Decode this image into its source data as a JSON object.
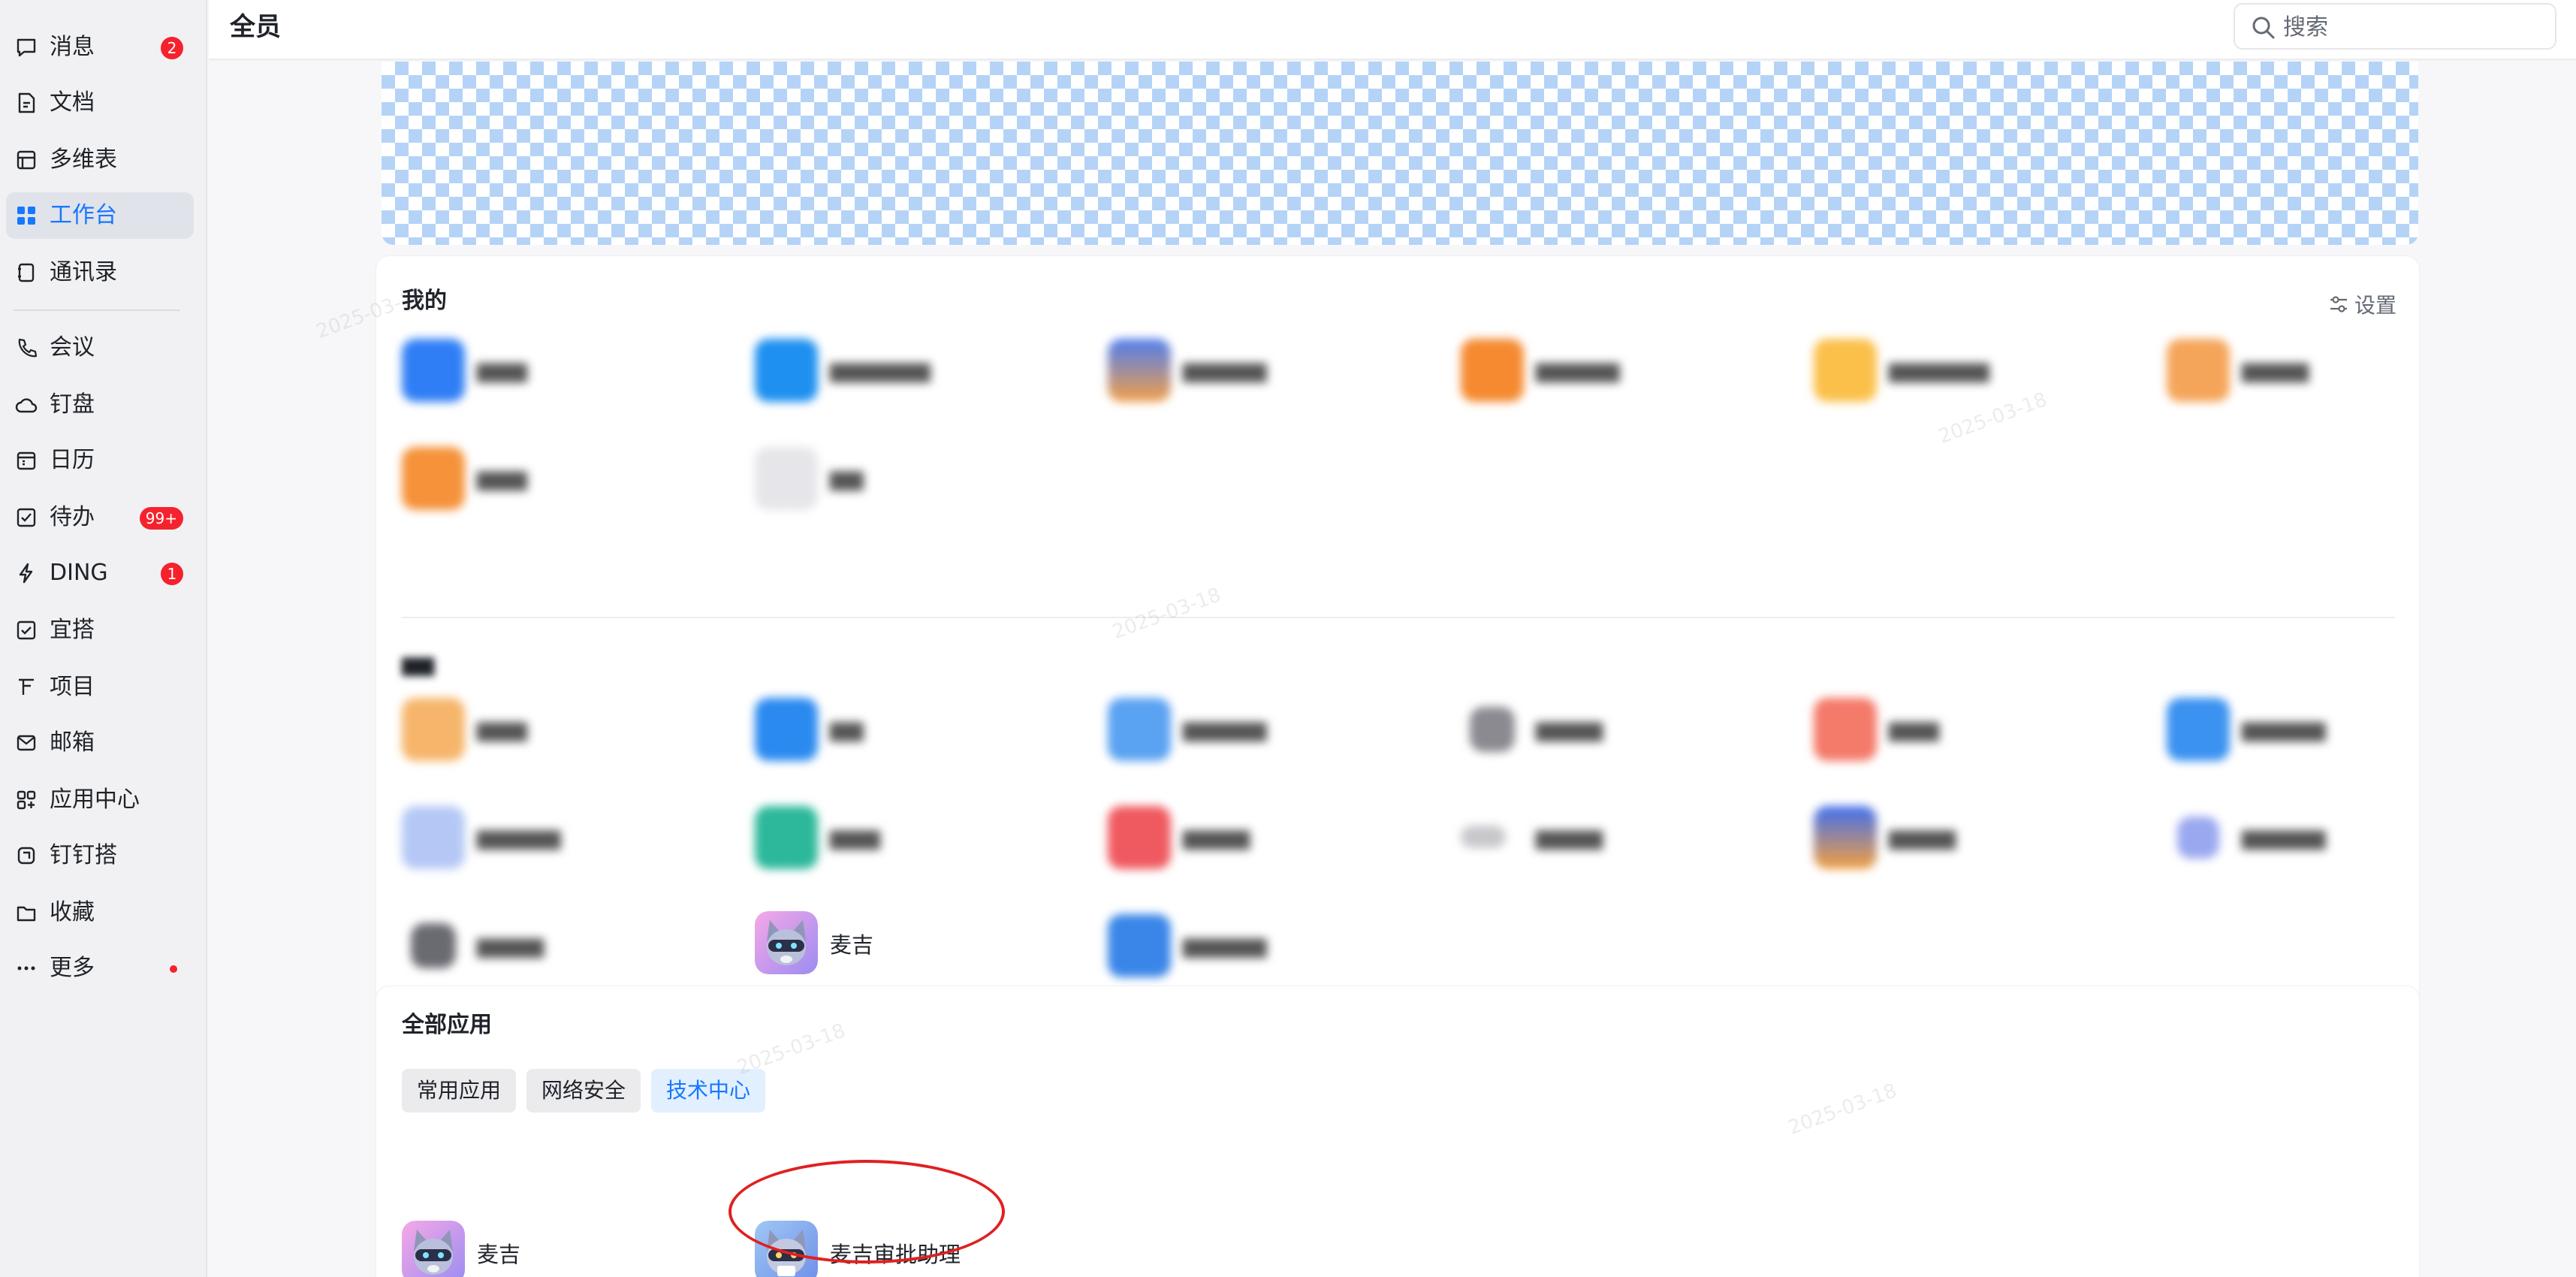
{
  "sidebar": {
    "items": [
      {
        "label": "消息",
        "icon": "chat-bubble-icon",
        "badge": "2"
      },
      {
        "label": "文档",
        "icon": "document-icon"
      },
      {
        "label": "多维表",
        "icon": "table-icon"
      },
      {
        "label": "工作台",
        "icon": "grid-icon",
        "active": true
      },
      {
        "label": "通讯录",
        "icon": "contacts-icon"
      },
      {
        "label": "会议",
        "icon": "phone-icon"
      },
      {
        "label": "钉盘",
        "icon": "cloud-icon"
      },
      {
        "label": "日历",
        "icon": "calendar-icon"
      },
      {
        "label": "待办",
        "icon": "checkbox-icon",
        "badge": "99+"
      },
      {
        "label": "DING",
        "icon": "lightning-icon",
        "badge": "1"
      },
      {
        "label": "宜搭",
        "icon": "form-icon"
      },
      {
        "label": "项目",
        "icon": "project-icon"
      },
      {
        "label": "邮箱",
        "icon": "mail-icon"
      },
      {
        "label": "应用中心",
        "icon": "apps-icon"
      },
      {
        "label": "钉钉搭",
        "icon": "builder-icon"
      },
      {
        "label": "收藏",
        "icon": "folder-icon"
      },
      {
        "label": "更多",
        "icon": "more-icon",
        "dot": true
      }
    ]
  },
  "header": {
    "title": "全员",
    "search_placeholder": "搜索"
  },
  "my_section": {
    "title": "我的",
    "settings_label": "设置",
    "app_label": "麦吉"
  },
  "all_apps": {
    "title": "全部应用",
    "tabs": [
      "常用应用",
      "网络安全",
      "技术中心"
    ],
    "active_tab": "技术中心",
    "apps": [
      "麦吉",
      "麦吉审批助理"
    ]
  },
  "watermark_text": "2025-03-18",
  "colors": {
    "accent": "#1677ff",
    "badge": "#f5222d",
    "annotation": "#e02020"
  }
}
